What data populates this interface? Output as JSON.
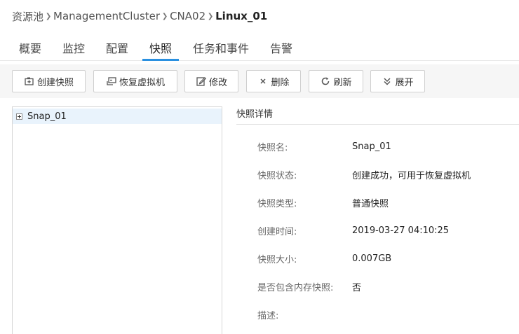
{
  "breadcrumb": {
    "items": [
      "资源池",
      "ManagementCluster",
      "CNA02"
    ],
    "current": "Linux_01",
    "separator": "›"
  },
  "tabs": [
    {
      "label": "概要",
      "active": false
    },
    {
      "label": "监控",
      "active": false
    },
    {
      "label": "配置",
      "active": false
    },
    {
      "label": "快照",
      "active": true
    },
    {
      "label": "任务和事件",
      "active": false
    },
    {
      "label": "告警",
      "active": false
    }
  ],
  "toolbar": {
    "create_label": "创建快照",
    "restore_label": "恢复虚拟机",
    "edit_label": "修改",
    "delete_label": "删除",
    "refresh_label": "刷新",
    "expand_label": "展开"
  },
  "tree": {
    "items": [
      {
        "label": "Snap_01",
        "selected": true
      }
    ]
  },
  "details": {
    "title": "快照详情",
    "rows": [
      {
        "label": "快照名:",
        "value": "Snap_01"
      },
      {
        "label": "快照状态:",
        "value": "创建成功，可用于恢复虚拟机"
      },
      {
        "label": "快照类型:",
        "value": "普通快照"
      },
      {
        "label": "创建时间:",
        "value": "2019-03-27 04:10:25"
      },
      {
        "label": "快照大小:",
        "value": "0.007GB"
      },
      {
        "label": "是否包含内存快照:",
        "value": "否"
      },
      {
        "label": "描述:",
        "value": ""
      }
    ]
  },
  "colors": {
    "accent": "#2a90e0",
    "selected_row": "#e9f3fc",
    "toolbar_bg": "#f6f6f6"
  },
  "icons": [
    "camera-plus-icon",
    "restore-vm-icon",
    "edit-icon",
    "close-icon",
    "refresh-icon",
    "expand-chevrons-icon",
    "tree-expander-icon"
  ]
}
